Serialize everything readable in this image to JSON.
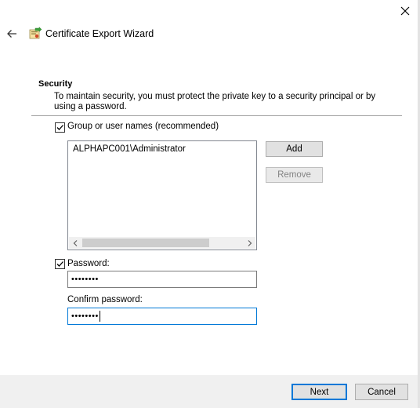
{
  "window": {
    "title": "Certificate Export Wizard"
  },
  "icons": {
    "close": "close-icon",
    "back": "back-arrow-icon",
    "wizard": "certificate-wizard-icon",
    "check": "checkmark-icon"
  },
  "colors": {
    "accent": "#0078d7",
    "footer_bg": "#f0f0f0",
    "disabled_text": "#838383"
  },
  "security": {
    "heading": "Security",
    "description": "To maintain security, you must protect the private key to a security principal or by using a password.",
    "group_option": {
      "label": "Group or user names (recommended)",
      "checked": true
    },
    "principals": [
      "ALPHAPC001\\Administrator"
    ],
    "add_label": "Add",
    "remove_label": "Remove",
    "password_option": {
      "label": "Password:",
      "checked": true
    },
    "password_value": "••••••••",
    "confirm_label": "Confirm password:",
    "confirm_value": "••••••••"
  },
  "footer": {
    "next_label": "Next",
    "cancel_label": "Cancel"
  }
}
